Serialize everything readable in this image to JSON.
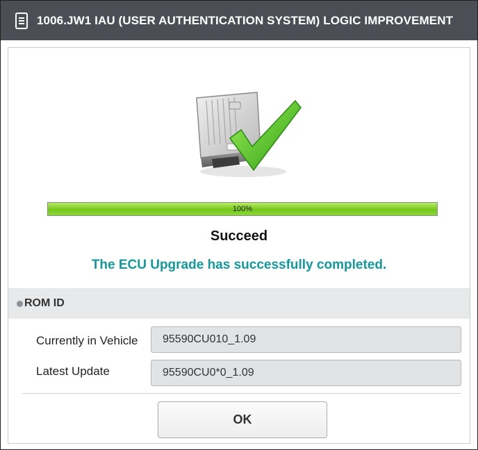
{
  "dialog": {
    "title": "1006.JW1 IAU (USER AUTHENTICATION SYSTEM) LOGIC IMPROVEMENT",
    "title_icon": "document-icon"
  },
  "progress": {
    "value": 1.0,
    "label": "100%",
    "fill_color": "#7dcd25"
  },
  "status": {
    "title": "Succeed",
    "message": "The ECU Upgrade has successfully completed.",
    "message_color": "#12999c"
  },
  "rom_id": {
    "section_label": "ROM ID",
    "rows": [
      {
        "label": "Currently in Vehicle",
        "value": "95590CU010_1.09"
      },
      {
        "label": "Latest Update",
        "value": "95590CU0*0_1.09"
      }
    ]
  },
  "buttons": {
    "ok_label": "OK"
  },
  "graphic": {
    "name": "ecu-module-with-checkmark",
    "check_color": "#3cbd1c"
  }
}
